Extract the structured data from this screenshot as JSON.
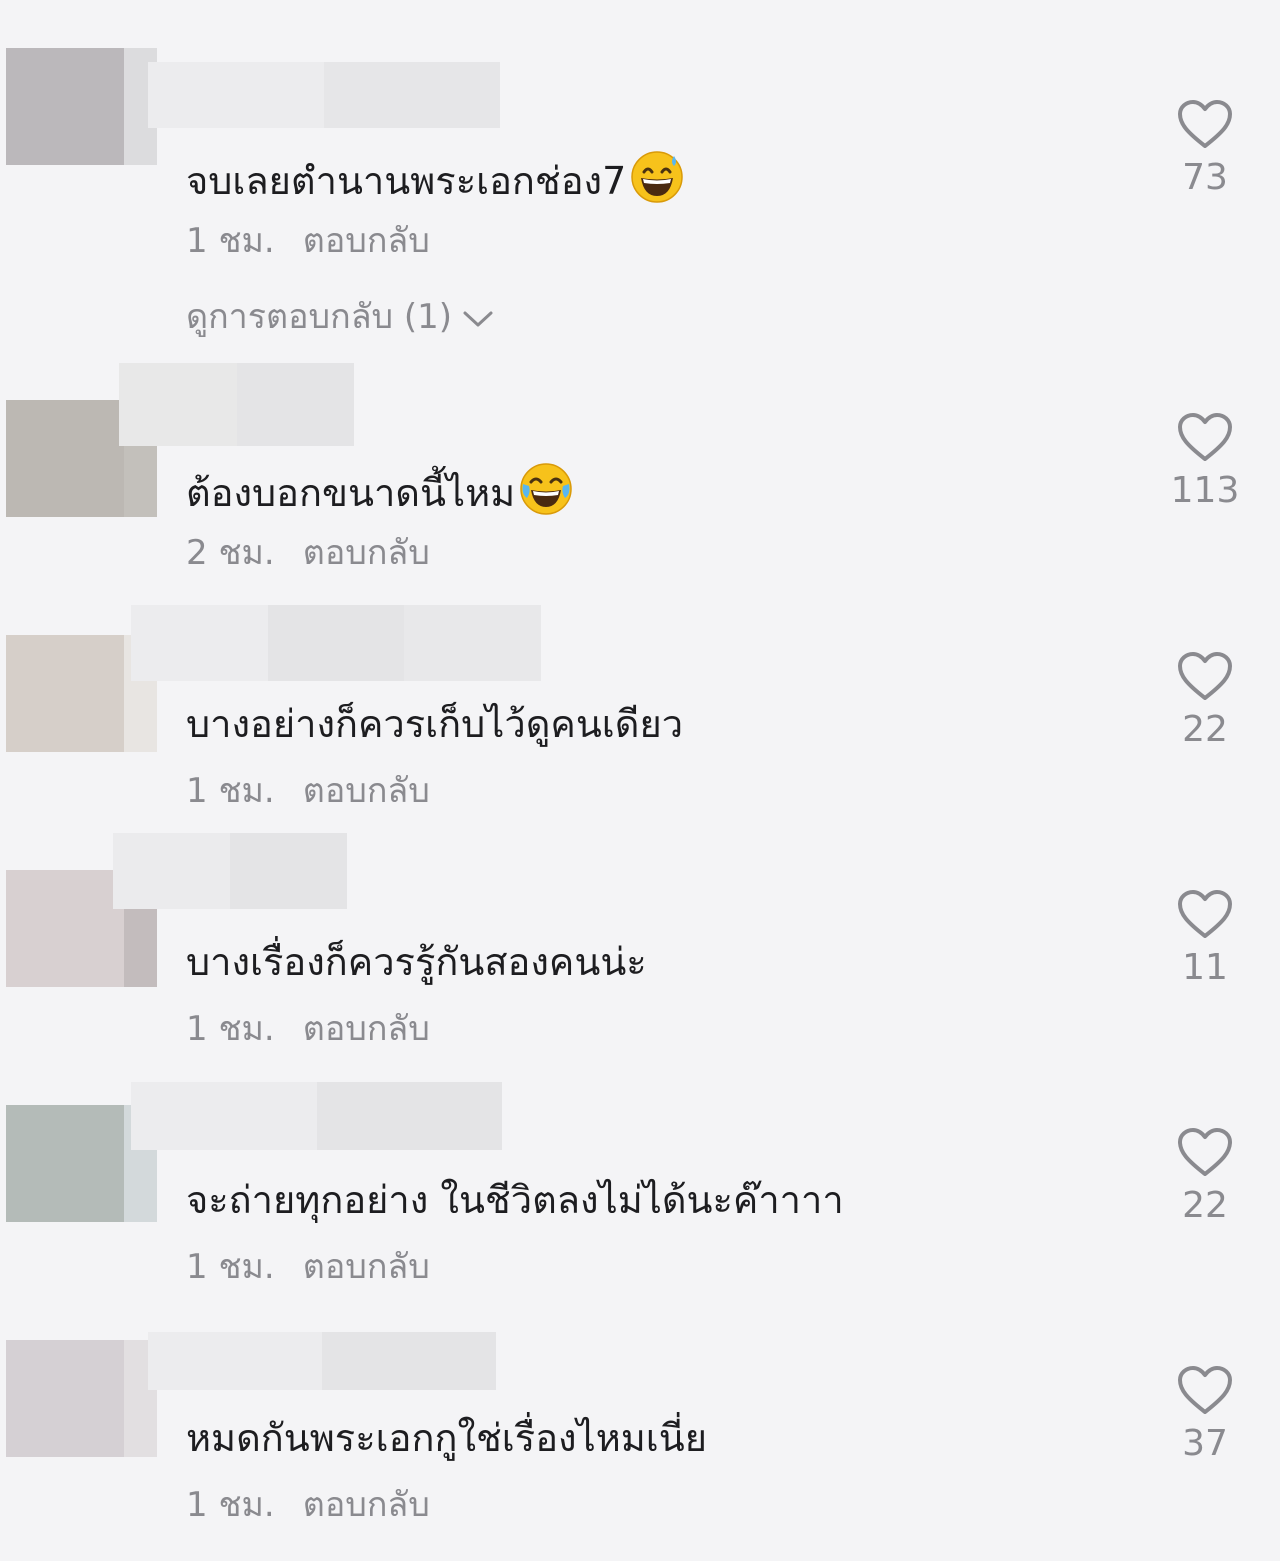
{
  "comments": [
    {
      "text": "จบเลยตำนานพระเอกช่อง7",
      "emoji": "grinning-face-with-sweat",
      "time": "1 ชม.",
      "reply_label": "ตอบกลับ",
      "view_replies": "ดูการตอบกลับ (1)",
      "likes": "73",
      "avatar_colors": [
        "#bbb8bb",
        "#dcdcde"
      ],
      "name_blur_colors": [
        "#ececee",
        "#e6e6e8"
      ]
    },
    {
      "text": "ต้องบอกขนาดนี้ไหม",
      "emoji": "face-with-tears-of-joy",
      "time": "2 ชม.",
      "reply_label": "ตอบกลับ",
      "likes": "113",
      "avatar_colors": [
        "#bcb8b3",
        "#c3c0bb"
      ],
      "name_blur_colors": [
        "#e8e8e8",
        "#e4e4e6"
      ]
    },
    {
      "text": "บางอย่างก็ควรเก็บไว้ดูคนเดียว",
      "time": "1 ชม.",
      "reply_label": "ตอบกลับ",
      "likes": "22",
      "avatar_colors": [
        "#d6cfc9",
        "#e8e5e2"
      ],
      "name_blur_colors": [
        "#ececee",
        "#e4e4e6"
      ]
    },
    {
      "text": "บางเรื่องก็ควรรู้กันสองคนน่ะ",
      "time": "1 ชม.",
      "reply_label": "ตอบกลับ",
      "likes": "11",
      "avatar_colors": [
        "#d8d0d1",
        "#c3bcbd"
      ],
      "name_blur_colors": [
        "#ebebed",
        "#e4e4e6"
      ]
    },
    {
      "text": "จะถ่ายทุกอย่าง ในชีวิตลงไม่ได้นะค๊าาาา",
      "time": "1 ชม.",
      "reply_label": "ตอบกลับ",
      "likes": "22",
      "avatar_colors": [
        "#b4bbb8",
        "#d3d9db"
      ],
      "name_blur_colors": [
        "#ececee",
        "#e4e4e6"
      ]
    },
    {
      "text": "หมดกันพระเอกกูใช่เรื่องไหมเนี่ย",
      "time": "1 ชม.",
      "reply_label": "ตอบกลับ",
      "likes": "37",
      "avatar_colors": [
        "#d5d0d4",
        "#e2dfe1"
      ],
      "name_blur_colors": [
        "#ececee",
        "#e4e4e6"
      ]
    }
  ],
  "icons": {
    "like": "heart-outline-icon",
    "expand": "chevron-down-icon"
  },
  "colors": {
    "background": "#f4f4f6",
    "text": "#1d1d20",
    "muted": "#8a8a8f"
  }
}
